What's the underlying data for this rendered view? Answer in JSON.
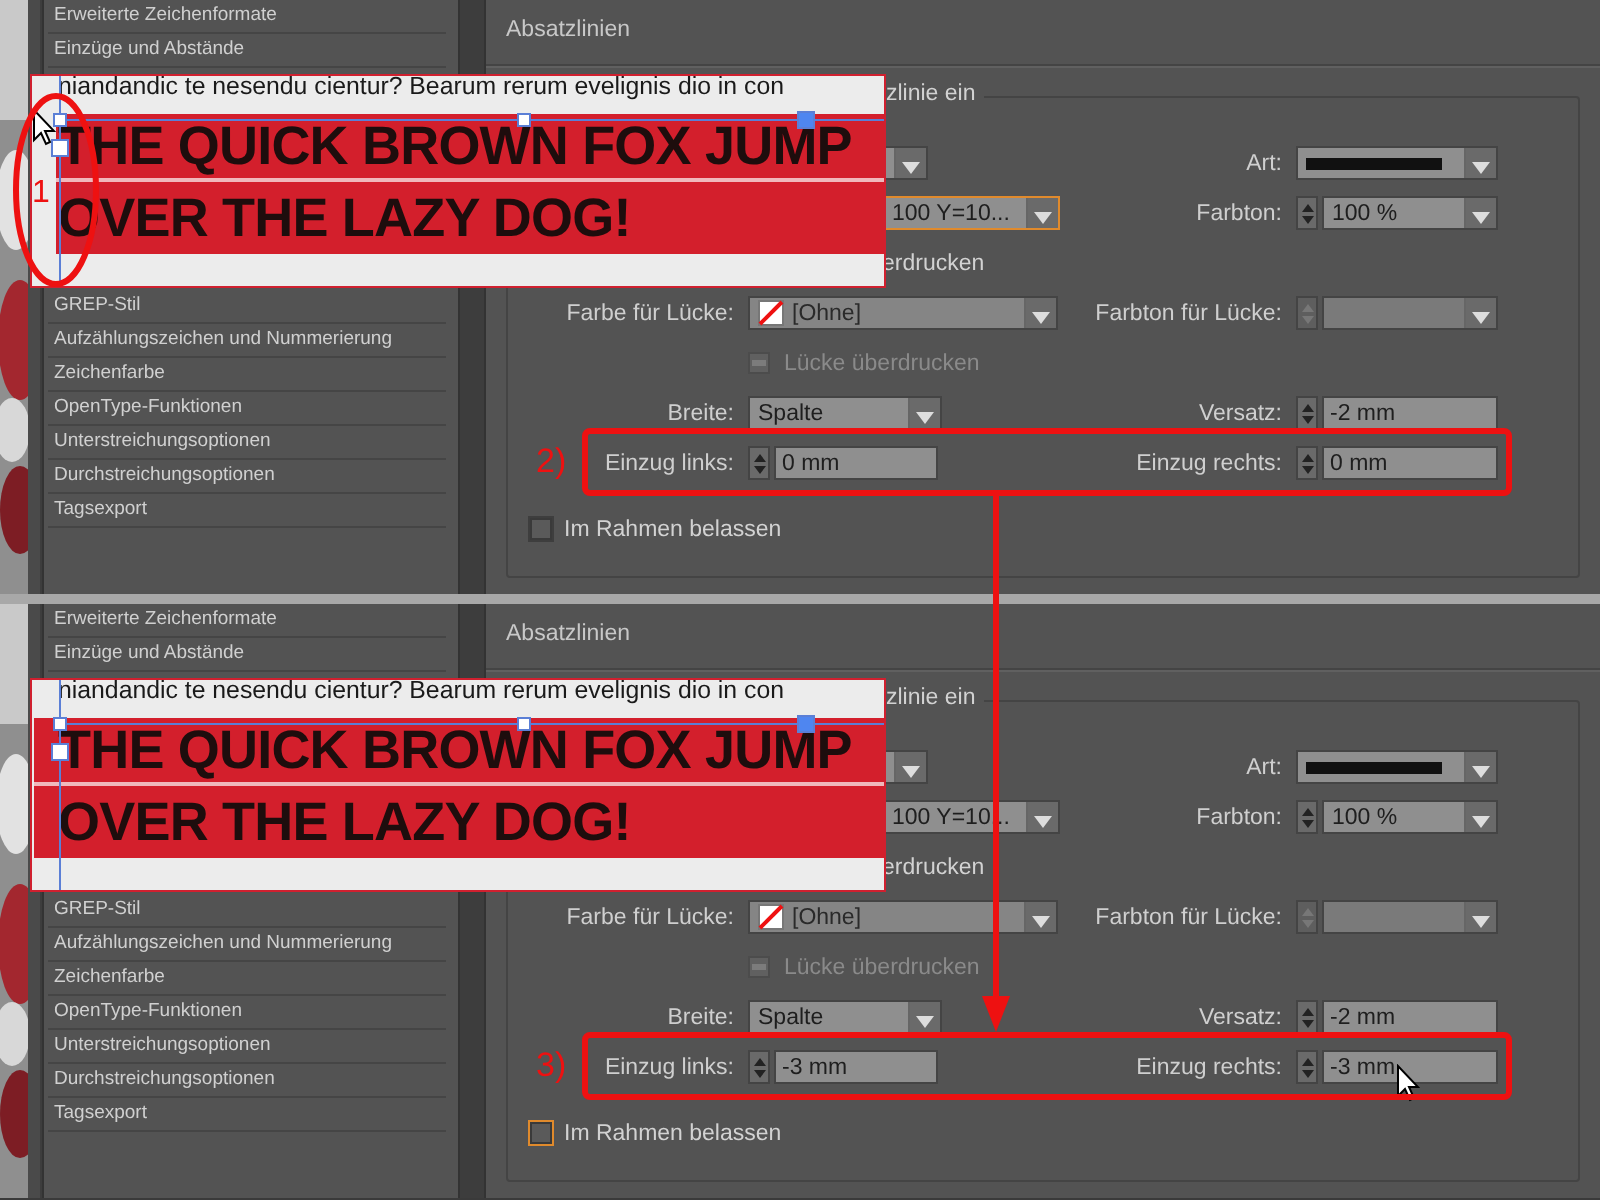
{
  "panels": [
    {
      "sidebar": {
        "top_items": [
          "Erweiterte Zeichenformate",
          "Einzüge und Abstände"
        ],
        "bottom_items": [
          "GREP-Stil",
          "Aufzählungszeichen und Nummerierung",
          "Zeichenfarbe",
          "OpenType-Funktionen",
          "Unterstreichungsoptionen",
          "Durchstreichungsoptionen",
          "Tagsexport"
        ]
      },
      "section_title": "Absatzlinien",
      "group_legend": "zlinie ein",
      "fill_dropdown": {
        "value": "100 Y=10...",
        "focused": true
      },
      "art": {
        "label": "Art:"
      },
      "tint": {
        "label": "Farbton:",
        "value": "100 %"
      },
      "overprint_label": "erdrucken",
      "gap_color": {
        "label": "Farbe für Lücke:",
        "value": "[Ohne]"
      },
      "gap_tint": {
        "label": "Farbton für Lücke:",
        "disabled": true
      },
      "gap_overprint": {
        "label": "Lücke überdrucken",
        "disabled": true
      },
      "width": {
        "label": "Breite:",
        "value": "Spalte"
      },
      "offset": {
        "label": "Versatz:",
        "value": "-2 mm"
      },
      "indent_left": {
        "label": "Einzug links:",
        "value": "0 mm"
      },
      "indent_right": {
        "label": "Einzug rechts:",
        "value": "0 mm",
        "pointer": false
      },
      "keep_in_frame": {
        "label": "Im Rahmen belassen",
        "checked": false,
        "focused": false
      },
      "sample": {
        "text_line": "niandandic te nesendu cientur? Bearum rerum evelignis dio in con",
        "lines": [
          "THE QUICK BROWN FOX JUMP",
          "OVER THE LAZY DOG!"
        ],
        "rules_extended": false,
        "pointer": true
      },
      "callouts": [
        {
          "kind": "ellipse",
          "label": "1"
        },
        {
          "kind": "box",
          "label": "2)"
        }
      ]
    },
    {
      "sidebar": {
        "top_items": [
          "Erweiterte Zeichenformate",
          "Einzüge und Abstände"
        ],
        "bottom_items": [
          "GREP-Stil",
          "Aufzählungszeichen und Nummerierung",
          "Zeichenfarbe",
          "OpenType-Funktionen",
          "Unterstreichungsoptionen",
          "Durchstreichungsoptionen",
          "Tagsexport"
        ]
      },
      "section_title": "Absatzlinien",
      "group_legend": "zlinie ein",
      "fill_dropdown": {
        "value": "100 Y=10...",
        "focused": false
      },
      "art": {
        "label": "Art:"
      },
      "tint": {
        "label": "Farbton:",
        "value": "100 %"
      },
      "overprint_label": "erdrucken",
      "gap_color": {
        "label": "Farbe für Lücke:",
        "value": "[Ohne]"
      },
      "gap_tint": {
        "label": "Farbton für Lücke:",
        "disabled": true
      },
      "gap_overprint": {
        "label": "Lücke überdrucken",
        "disabled": true
      },
      "width": {
        "label": "Breite:",
        "value": "Spalte"
      },
      "offset": {
        "label": "Versatz:",
        "value": "-2 mm"
      },
      "indent_left": {
        "label": "Einzug links:",
        "value": "-3 mm"
      },
      "indent_right": {
        "label": "Einzug rechts:",
        "value": "-3 mm",
        "pointer": true
      },
      "keep_in_frame": {
        "label": "Im Rahmen belassen",
        "checked": false,
        "focused": true
      },
      "sample": {
        "text_line": "niandandic te nesendu cientur? Bearum rerum evelignis dio in con",
        "lines": [
          "THE QUICK BROWN FOX JUMP",
          "OVER THE LAZY DOG!"
        ],
        "rules_extended": true,
        "pointer": false
      },
      "callouts": [
        {
          "kind": "box",
          "label": "3)"
        }
      ]
    }
  ]
}
